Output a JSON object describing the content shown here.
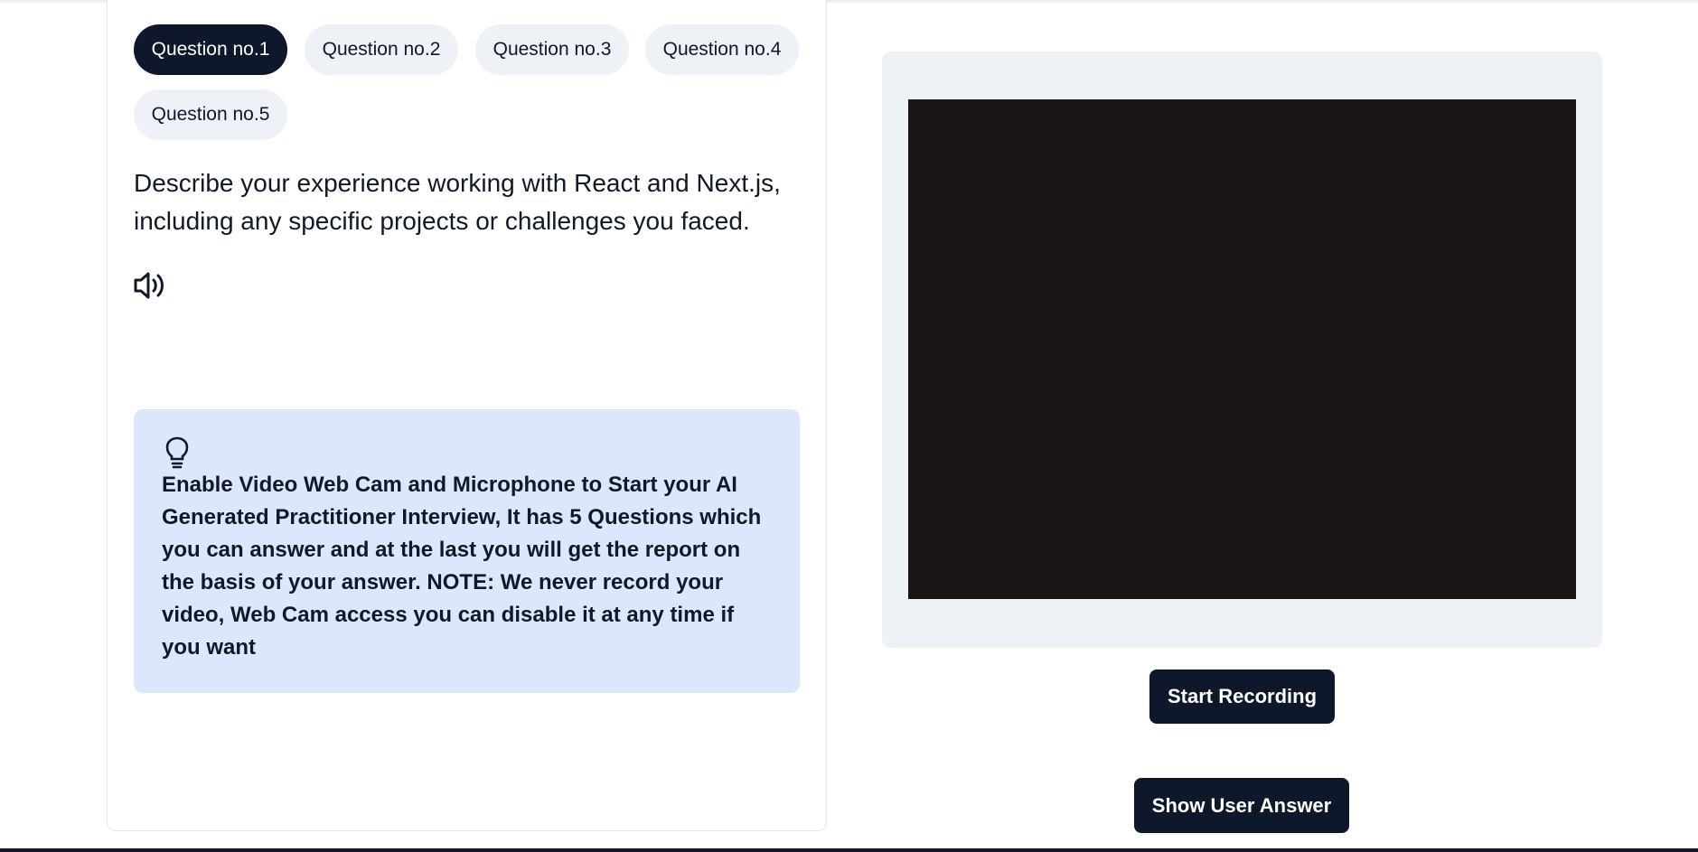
{
  "tabs": [
    {
      "label": "Question no.1",
      "active": true
    },
    {
      "label": "Question no.2",
      "active": false
    },
    {
      "label": "Question no.3",
      "active": false
    },
    {
      "label": "Question no.4",
      "active": false
    },
    {
      "label": "Question no.5",
      "active": false
    }
  ],
  "question": {
    "text": "Describe your experience working with React and Next.js, including any specific projects or challenges you faced.",
    "speaker_icon": "volume-icon"
  },
  "hint": {
    "icon": "lightbulb-icon",
    "text": "Enable Video Web Cam and Microphone to Start your AI Generated Practitioner Interview, It has 5 Questions which you can answer and at the last you will get the report on the basis of your answer. NOTE: We never record your video, Web Cam access you can disable it at any time if you want"
  },
  "actions": {
    "start_recording": "Start Recording",
    "show_user_answer": "Show User Answer"
  },
  "colors": {
    "primary": "#0f172a",
    "tab_inactive": "#eef2f7",
    "hint_bg": "#dbe8fc",
    "webcam_bg": "#1a1616"
  }
}
